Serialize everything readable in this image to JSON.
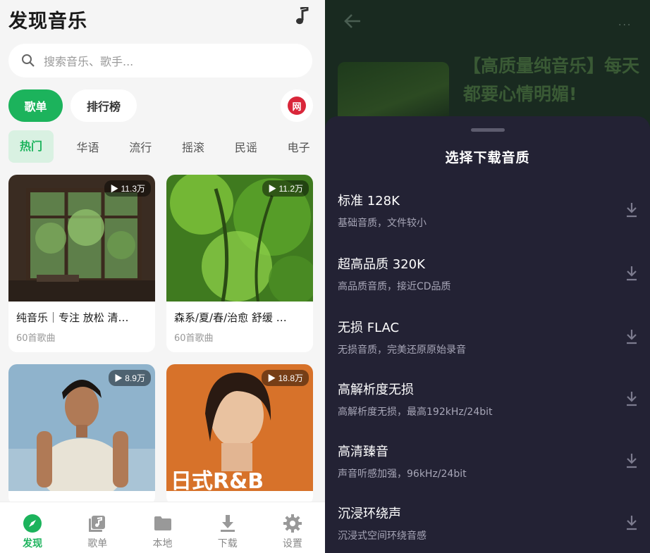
{
  "discover": {
    "title": "发现音乐",
    "search_placeholder": "搜索音乐、歌手...",
    "tabs": {
      "playlist": "歌单",
      "ranking": "排行榜"
    },
    "netease_badge": "网",
    "categories": [
      "热门",
      "华语",
      "流行",
      "摇滚",
      "民谣",
      "电子"
    ],
    "cards": [
      {
        "count": "▶ 11.3万",
        "title": "纯音乐｜专注 放松 清…",
        "subtitle": "60首歌曲"
      },
      {
        "count": "▶ 11.2万",
        "title": "森系/夏/春/治愈 舒缓 …",
        "subtitle": "60首歌曲"
      },
      {
        "count": "▶ 8.9万",
        "title": "",
        "subtitle": ""
      },
      {
        "count": "▶ 18.8万",
        "title": "",
        "subtitle": "",
        "art_text": "日式R&B"
      }
    ],
    "bottom_nav": [
      {
        "label": "发现",
        "icon": "compass-icon",
        "active": true
      },
      {
        "label": "歌单",
        "icon": "music-library-icon",
        "active": false
      },
      {
        "label": "本地",
        "icon": "folder-icon",
        "active": false
      },
      {
        "label": "下载",
        "icon": "download-icon",
        "active": false
      },
      {
        "label": "设置",
        "icon": "gear-icon",
        "active": false
      }
    ]
  },
  "detail": {
    "more": "···",
    "playlist_title": "【高质量纯音乐】每天都要心情明媚!"
  },
  "quality_sheet": {
    "title": "选择下载音质",
    "options": [
      {
        "name": "标准 128K",
        "desc": "基础音质，文件较小"
      },
      {
        "name": "超高品质 320K",
        "desc": "高品质音质，接近CD品质"
      },
      {
        "name": "无损 FLAC",
        "desc": "无损音质，完美还原原始录音"
      },
      {
        "name": "高解析度无损",
        "desc": "高解析度无损，最高192kHz/24bit"
      },
      {
        "name": "高清臻音",
        "desc": "声音听感加强，96kHz/24bit"
      },
      {
        "name": "沉浸环绕声",
        "desc": "沉浸式空间环绕音感"
      }
    ]
  },
  "colors": {
    "accent": "#1cb35c",
    "sheet_bg": "#232234",
    "netease_red": "#d9263a"
  }
}
